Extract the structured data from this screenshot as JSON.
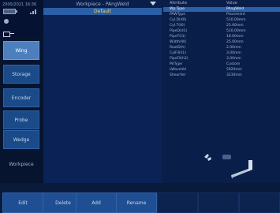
{
  "status": {
    "text": "2000/2021 16:36"
  },
  "nav": {
    "items": [
      {
        "label": "Wing",
        "state": "active"
      },
      {
        "label": "Storage",
        "state": "normal"
      },
      {
        "label": "Encoder",
        "state": "normal"
      },
      {
        "label": "Probe",
        "state": "normal"
      },
      {
        "label": "Wedge",
        "state": "normal"
      },
      {
        "label": "Workpiece",
        "state": "selected"
      }
    ]
  },
  "workpiece": {
    "title": "Workpiece - PAngWeld",
    "selected_item": "Default"
  },
  "properties": {
    "headers": {
      "attribute": "Attribute",
      "value": "Value"
    },
    "rows": [
      {
        "key": "Wp.Type",
        "value": "PAngWeld"
      },
      {
        "key": "PAWType",
        "value": "Placement"
      },
      {
        "key": "Cyl.D(d0)",
        "value": "510.00mm"
      },
      {
        "key": "Cyl.T(t0)",
        "value": "25.00mm"
      },
      {
        "key": "PipeD(d1)",
        "value": "510.00mm"
      },
      {
        "key": "PipeT(t1)",
        "value": "18.00mm"
      },
      {
        "key": "Width(W)",
        "value": "25.00mm"
      },
      {
        "key": "RootD(h)",
        "value": "2.00mm"
      },
      {
        "key": "CylFil(h1)",
        "value": "3.00mm"
      },
      {
        "key": "PipeFil(h2)",
        "value": "3.00mm"
      },
      {
        "key": "MrType",
        "value": "Custom"
      },
      {
        "key": "LWaveVel",
        "value": "5920m/s"
      },
      {
        "key": "ShearVel",
        "value": "3230m/s"
      }
    ]
  },
  "toolbar": {
    "buttons": [
      "Edit",
      "Delete",
      "Add",
      "Rename"
    ]
  },
  "colors": {
    "accent": "#2b5fa6",
    "selected_text": "#ffd24a",
    "background": "#0b1e46"
  }
}
